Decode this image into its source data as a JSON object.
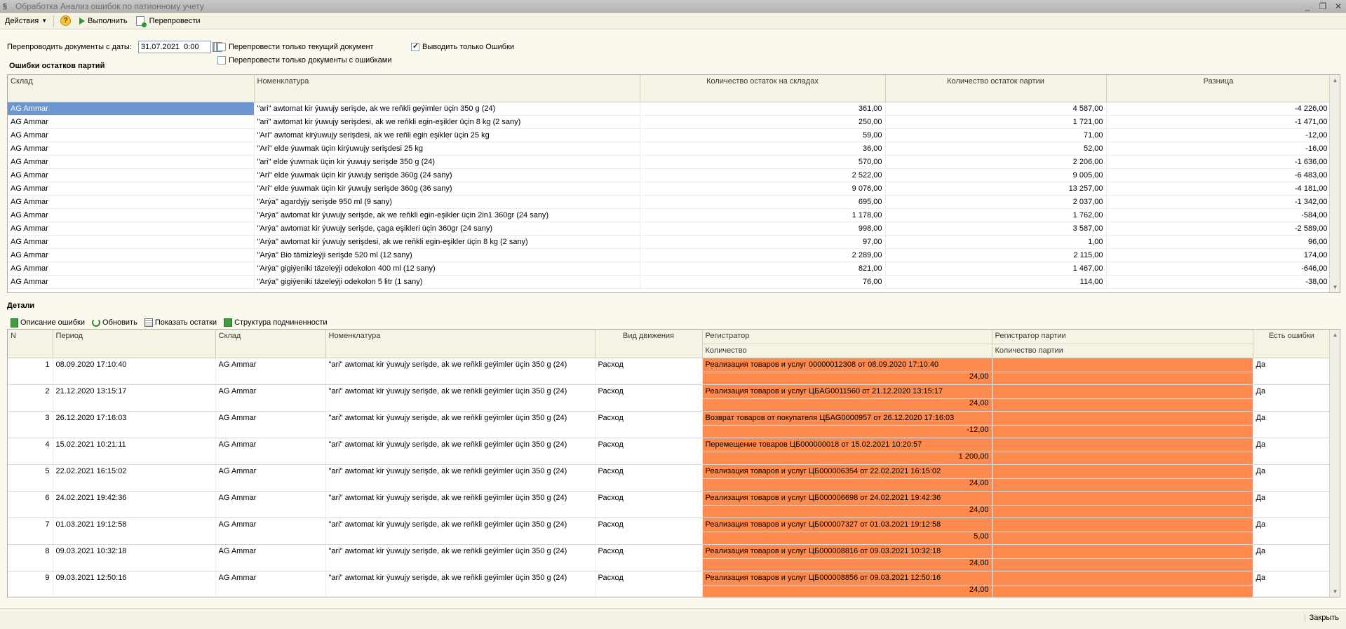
{
  "window": {
    "title": "Обработка  Анализ ошибок по патионному учету",
    "controls": [
      "_",
      "❐",
      "✕"
    ]
  },
  "toolbar": {
    "actions_label": "Действия",
    "help_label": "?",
    "run_label": "Выполнить",
    "repost_label": "Перепровести"
  },
  "filters": {
    "date_label": "Перепроводить документы с даты:",
    "date_value": "31.07.2021  0:00",
    "only_current_label": "Перепровести только текущий документ",
    "only_current_checked": false,
    "only_errors_docs_label": "Перепровести только документы с ошибками",
    "only_errors_docs_checked": false,
    "show_only_errors_label": "Выводить только Ошибки",
    "show_only_errors_checked": true
  },
  "errors_section": {
    "title": "Ошибки остатков партий",
    "columns": [
      "Склад",
      "Номенклатура",
      "Количество остаток на складах",
      "Количество остаток партии",
      "Разница"
    ],
    "rows": [
      [
        "AG Ammar",
        "\"ari\" awtomat kir ýuwujy serişde, ak we reňkli geýimler üçin 350 g (24)",
        "361,00",
        "4 587,00",
        "-4 226,00"
      ],
      [
        "AG Ammar",
        "\"ari\" awtomat kir ýuwujy serişdesi, ak we reňkli egin-eşikler üçin 8 kg (2 sany)",
        "250,00",
        "1 721,00",
        "-1 471,00"
      ],
      [
        "AG Ammar",
        "\"Ari\" awtomat kirýuwujy serişdesi, ak we reňli egin eşikler üçin 25 kg",
        "59,00",
        "71,00",
        "-12,00"
      ],
      [
        "AG Ammar",
        "\"Ari\" elde ýuwmak üçin  kirýuwujy serişdesi  25 kg",
        "36,00",
        "52,00",
        "-16,00"
      ],
      [
        "AG Ammar",
        "\"ari\" elde ýuwmak üçin kir ýuwujy serişde 350 g (24)",
        "570,00",
        "2 206,00",
        "-1 636,00"
      ],
      [
        "AG Ammar",
        "\"Ari\" elde ýuwmak üçin kir ýuwujy serişde 360g (24 sany)",
        "2 522,00",
        "9 005,00",
        "-6 483,00"
      ],
      [
        "AG Ammar",
        "\"Ari\" elde ýuwmak üçin kir ýuwujy serişde 360g (36 sany)",
        "9 076,00",
        "13 257,00",
        "-4 181,00"
      ],
      [
        "AG Ammar",
        "\"Arýa\" agardyjy serişde 950 ml  (9 sany)",
        "695,00",
        "2 037,00",
        "-1 342,00"
      ],
      [
        "AG Ammar",
        "\"Arýa\" awtomat kir ýuwujy serişde, ak we reňkli egin-eşikler üçin 2in1  360gr (24 sany)",
        "1 178,00",
        "1 762,00",
        "-584,00"
      ],
      [
        "AG Ammar",
        "\"Arýa\" awtomat kir ýuwujy serişde, çaga eşikleri üçin 360gr (24 sany)",
        "998,00",
        "3 587,00",
        "-2 589,00"
      ],
      [
        "AG Ammar",
        "\"Arýa\" awtomat kir ýuwujy serişdesi, ak we reňkli egin-eşikler üçin 8 kg (2 sany)",
        "97,00",
        "1,00",
        "96,00"
      ],
      [
        "AG Ammar",
        "\"Arýa\" Bio tämizleýji  serişde 520 ml (12 sany)",
        "2 289,00",
        "2 115,00",
        "174,00"
      ],
      [
        "AG Ammar",
        "\"Arýa\" gigiýeniki täzeleýji odekolon 400 ml (12 sany)",
        "821,00",
        "1 467,00",
        "-646,00"
      ],
      [
        "AG Ammar",
        "\"Arýa\" gigiýeniki täzeleýji odekolon 5 litr  (1 sany)",
        "76,00",
        "114,00",
        "-38,00"
      ]
    ]
  },
  "details_section": {
    "title": "Детали",
    "toolbar": {
      "description_label": "Описание ошибки",
      "refresh_label": "Обновить",
      "show_balances_label": "Показать остатки",
      "structure_label": "Структура подчиненности"
    },
    "columns": {
      "n": "N",
      "period": "Период",
      "warehouse": "Склад",
      "nomenclature": "Номенклатура",
      "movement": "Вид движения",
      "registrar": "Регистратор",
      "quantity": "Количество",
      "batch_registrar": "Регистратор партии",
      "batch_quantity": "Количество партии",
      "has_errors": "Есть ошибки"
    },
    "rows": [
      {
        "n": "1",
        "period": "08.09.2020 17:10:40",
        "warehouse": "AG Ammar",
        "nomenclature": "\"ari\" awtomat kir ýuwujy serişde, ak we reňkli geýimler üçin 350 g (24)",
        "movement": "Расход",
        "registrar": "Реализация товаров и услуг 00000012308 от 08.09.2020 17:10:40",
        "quantity": "24,00",
        "has_errors": "Да"
      },
      {
        "n": "2",
        "period": "21.12.2020 13:15:17",
        "warehouse": "AG Ammar",
        "nomenclature": "\"ari\" awtomat kir ýuwujy serişde, ak we reňkli geýimler üçin 350 g (24)",
        "movement": "Расход",
        "registrar": "Реализация товаров и услуг ЦБAG0011560 от 21.12.2020 13:15:17",
        "quantity": "24,00",
        "has_errors": "Да"
      },
      {
        "n": "3",
        "period": "26.12.2020 17:16:03",
        "warehouse": "AG Ammar",
        "nomenclature": "\"ari\" awtomat kir ýuwujy serişde, ak we reňkli geýimler üçin 350 g (24)",
        "movement": "Расход",
        "registrar": "Возврат товаров от покупателя ЦБAG0000957 от 26.12.2020 17:16:03",
        "quantity": "-12,00",
        "has_errors": "Да"
      },
      {
        "n": "4",
        "period": "15.02.2021 10:21:11",
        "warehouse": "AG Ammar",
        "nomenclature": "\"ari\" awtomat kir ýuwujy serişde, ak we reňkli geýimler üçin 350 g (24)",
        "movement": "Расход",
        "registrar": "Перемещение товаров ЦБ000000018 от 15.02.2021 10:20:57",
        "quantity": "1 200,00",
        "has_errors": "Да"
      },
      {
        "n": "5",
        "period": "22.02.2021 16:15:02",
        "warehouse": "AG Ammar",
        "nomenclature": "\"ari\" awtomat kir ýuwujy serişde, ak we reňkli geýimler üçin 350 g (24)",
        "movement": "Расход",
        "registrar": "Реализация товаров и услуг ЦБ000006354 от 22.02.2021 16:15:02",
        "quantity": "24,00",
        "has_errors": "Да"
      },
      {
        "n": "6",
        "period": "24.02.2021 19:42:36",
        "warehouse": "AG Ammar",
        "nomenclature": "\"ari\" awtomat kir ýuwujy serişde, ak we reňkli geýimler üçin 350 g (24)",
        "movement": "Расход",
        "registrar": "Реализация товаров и услуг ЦБ000006698 от 24.02.2021 19:42:36",
        "quantity": "24,00",
        "has_errors": "Да"
      },
      {
        "n": "7",
        "period": "01.03.2021 19:12:58",
        "warehouse": "AG Ammar",
        "nomenclature": "\"ari\" awtomat kir ýuwujy serişde, ak we reňkli geýimler üçin 350 g (24)",
        "movement": "Расход",
        "registrar": "Реализация товаров и услуг ЦБ000007327 от 01.03.2021 19:12:58",
        "quantity": "5,00",
        "has_errors": "Да"
      },
      {
        "n": "8",
        "period": "09.03.2021 10:32:18",
        "warehouse": "AG Ammar",
        "nomenclature": "\"ari\" awtomat kir ýuwujy serişde, ak we reňkli geýimler üçin 350 g (24)",
        "movement": "Расход",
        "registrar": "Реализация товаров и услуг ЦБ000008816 от 09.03.2021 10:32:18",
        "quantity": "24,00",
        "has_errors": "Да"
      },
      {
        "n": "9",
        "period": "09.03.2021 12:50:16",
        "warehouse": "AG Ammar",
        "nomenclature": "\"ari\" awtomat kir ýuwujy serişde, ak we reňkli geýimler üçin 350 g (24)",
        "movement": "Расход",
        "registrar": "Реализация товаров и услуг ЦБ000008856 от 09.03.2021 12:50:16",
        "quantity": "24,00",
        "has_errors": "Да"
      }
    ]
  },
  "statusbar": {
    "close_label": "Закрыть"
  },
  "colors": {
    "error_highlight": "#ff8a4d",
    "selected_row": "#6d96d0",
    "background": "#fbf9ee"
  }
}
